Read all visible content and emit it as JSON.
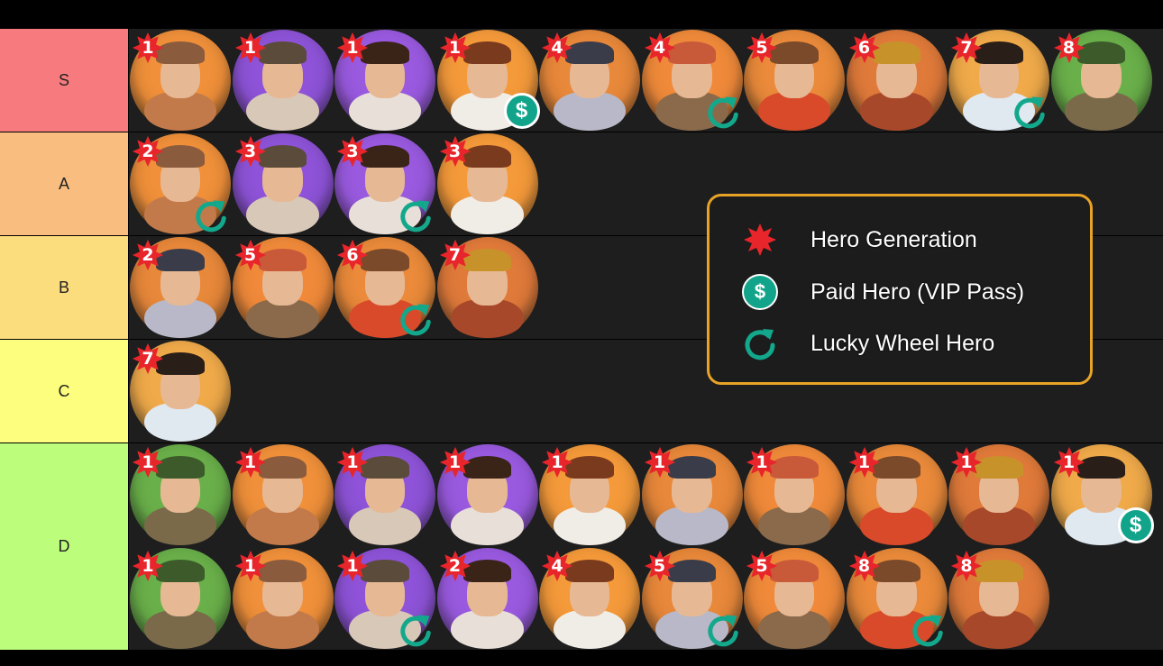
{
  "tiers": [
    {
      "label": "S",
      "color": "#f77b7e"
    },
    {
      "label": "A",
      "color": "#f9bd7f"
    },
    {
      "label": "B",
      "color": "#fcdd7e"
    },
    {
      "label": "C",
      "color": "#fdfe7d"
    },
    {
      "label": "D",
      "color": "#bcfe7c"
    }
  ],
  "legend": {
    "generation": "Hero Generation",
    "paid": "Paid Hero (VIP Pass)",
    "wheel": "Lucky Wheel Hero"
  },
  "icons": {
    "generation": "red-star-badge-icon",
    "paid": "dollar-coin-icon",
    "wheel": "circular-arrow-icon"
  },
  "colors": {
    "generation_badge": "#e8252b",
    "paid_badge": "#12a48b",
    "wheel_badge": "#13a88c",
    "legend_border": "#e8a326"
  },
  "symbols": {
    "dollar": "$"
  },
  "heroes": {
    "S": [
      {
        "gen": "1",
        "paid": false,
        "wheel": false
      },
      {
        "gen": "1",
        "paid": false,
        "wheel": false
      },
      {
        "gen": "1",
        "paid": false,
        "wheel": false
      },
      {
        "gen": "1",
        "paid": true,
        "wheel": false
      },
      {
        "gen": "4",
        "paid": false,
        "wheel": false
      },
      {
        "gen": "4",
        "paid": false,
        "wheel": true
      },
      {
        "gen": "5",
        "paid": false,
        "wheel": false
      },
      {
        "gen": "6",
        "paid": false,
        "wheel": false
      },
      {
        "gen": "7",
        "paid": false,
        "wheel": true
      },
      {
        "gen": "8",
        "paid": false,
        "wheel": false
      }
    ],
    "A": [
      {
        "gen": "2",
        "paid": false,
        "wheel": true
      },
      {
        "gen": "3",
        "paid": false,
        "wheel": false
      },
      {
        "gen": "3",
        "paid": false,
        "wheel": true
      },
      {
        "gen": "3",
        "paid": false,
        "wheel": false
      }
    ],
    "B": [
      {
        "gen": "2",
        "paid": false,
        "wheel": false
      },
      {
        "gen": "5",
        "paid": false,
        "wheel": false
      },
      {
        "gen": "6",
        "paid": false,
        "wheel": true
      },
      {
        "gen": "7",
        "paid": false,
        "wheel": false
      }
    ],
    "C": [
      {
        "gen": "7",
        "paid": false,
        "wheel": false
      }
    ],
    "D": [
      {
        "gen": "1",
        "paid": false,
        "wheel": false
      },
      {
        "gen": "1",
        "paid": false,
        "wheel": false
      },
      {
        "gen": "1",
        "paid": false,
        "wheel": false
      },
      {
        "gen": "1",
        "paid": false,
        "wheel": false
      },
      {
        "gen": "1",
        "paid": false,
        "wheel": false
      },
      {
        "gen": "1",
        "paid": false,
        "wheel": false
      },
      {
        "gen": "1",
        "paid": false,
        "wheel": false
      },
      {
        "gen": "1",
        "paid": false,
        "wheel": false
      },
      {
        "gen": "1",
        "paid": false,
        "wheel": false
      },
      {
        "gen": "1",
        "paid": true,
        "wheel": false
      },
      {
        "gen": "1",
        "paid": false,
        "wheel": false
      },
      {
        "gen": "1",
        "paid": false,
        "wheel": false
      },
      {
        "gen": "1",
        "paid": false,
        "wheel": true
      },
      {
        "gen": "2",
        "paid": false,
        "wheel": false
      },
      {
        "gen": "4",
        "paid": false,
        "wheel": false
      },
      {
        "gen": "5",
        "paid": false,
        "wheel": true
      },
      {
        "gen": "5",
        "paid": false,
        "wheel": false
      },
      {
        "gen": "8",
        "paid": false,
        "wheel": true
      },
      {
        "gen": "8",
        "paid": false,
        "wheel": false
      }
    ]
  }
}
